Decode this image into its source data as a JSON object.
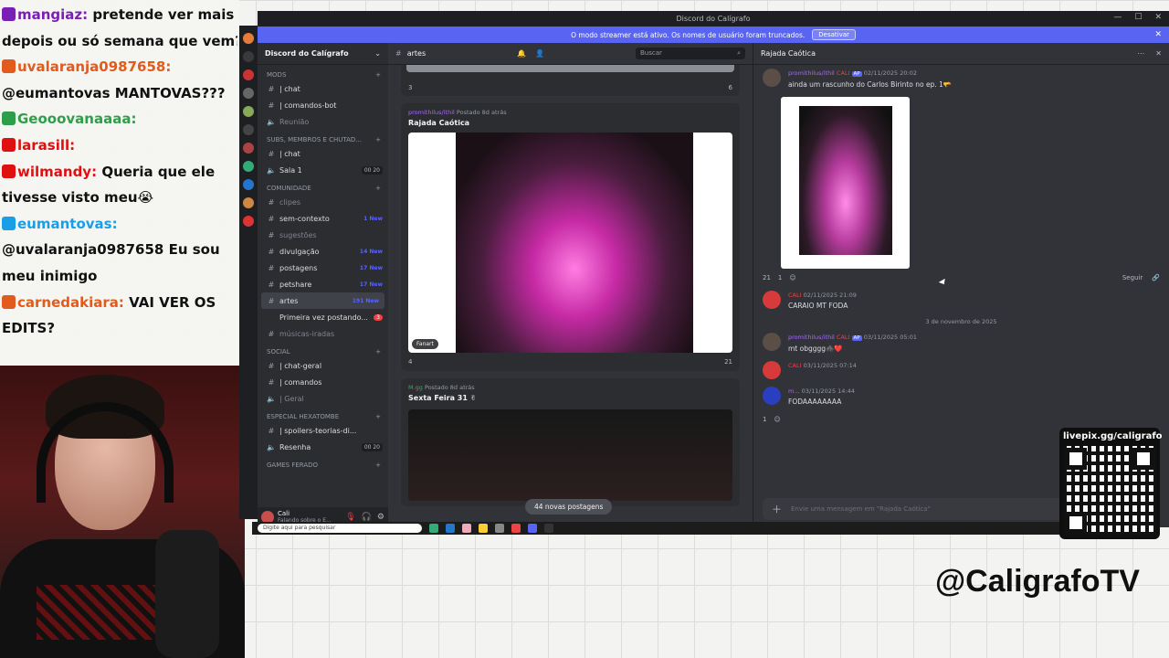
{
  "chat": {
    "lines": [
      {
        "user": "mangiaz:",
        "user_color": "#7a1fb3",
        "text": "pretende ver mais"
      },
      {
        "user": "",
        "text": "depois ou só semana que vem?"
      },
      {
        "user": "uvalaranja0987658:",
        "user_color": "#e25a1c",
        "text": ""
      },
      {
        "user": "",
        "text": "@eumantovas MANTOVAS???"
      },
      {
        "user": "Geooovanaaaa:",
        "user_color": "#2e9e4a",
        "text": ""
      },
      {
        "user": "larasill:",
        "user_color": "#e01010",
        "text": ""
      },
      {
        "user": "wilmandy:",
        "user_color": "#e01010",
        "text": "Queria que ele"
      },
      {
        "user": "",
        "text": "tivesse visto meu😭"
      },
      {
        "user": "eumantovas:",
        "user_color": "#1a9ee8",
        "text": ""
      },
      {
        "user": "",
        "text": "@uvalaranja0987658 Eu sou"
      },
      {
        "user": "",
        "text": "meu inimigo"
      },
      {
        "user": "carnedakiara:",
        "user_color": "#e25a1c",
        "text": "VAI VER OS"
      },
      {
        "user": "",
        "text": "EDITS?"
      }
    ]
  },
  "window": {
    "title": "Discord do Calígrafo",
    "controls": [
      "—",
      "☐",
      "✕"
    ]
  },
  "banner": {
    "text": "O modo streamer está ativo. Os nomes de usuário foram truncados.",
    "button": "Desativar",
    "close": "✕"
  },
  "server": {
    "name": "Discord do Calígrafo",
    "categories": [
      {
        "label": "MODS",
        "channels": [
          {
            "icon": "#",
            "name": "| chat"
          },
          {
            "icon": "#",
            "name": "| comandos-bot"
          },
          {
            "icon": "🔈",
            "name": "Reunião",
            "muted": true
          }
        ]
      },
      {
        "label": "SUBS, MEMBROS E CHUTAD...",
        "channels": [
          {
            "icon": "#",
            "name": "| chat"
          },
          {
            "icon": "🔈",
            "name": "Sala 1",
            "count": "00 20"
          }
        ]
      },
      {
        "label": "COMUNIDADE",
        "channels": [
          {
            "icon": "#",
            "name": "clipes",
            "muted": true
          },
          {
            "icon": "#",
            "name": "sem-contexto",
            "new": "1 New"
          },
          {
            "icon": "#",
            "name": "sugestões",
            "muted": true
          },
          {
            "icon": "#",
            "name": "divulgação",
            "new": "14 New"
          },
          {
            "icon": "#",
            "name": "postagens",
            "new": "17 New"
          },
          {
            "icon": "#",
            "name": "petshare",
            "new": "17 New"
          },
          {
            "icon": "#",
            "name": "artes",
            "new": "191 New",
            "active": true
          },
          {
            "icon": "",
            "name": "Primeira vez postando...",
            "badge": "3"
          },
          {
            "icon": "#",
            "name": "músicas-iradas",
            "muted": true
          }
        ]
      },
      {
        "label": "SOCIAL",
        "channels": [
          {
            "icon": "#",
            "name": "| chat-geral"
          },
          {
            "icon": "#",
            "name": "| comandos"
          },
          {
            "icon": "🔈",
            "name": "| Geral",
            "muted": true
          }
        ]
      },
      {
        "label": "ESPECIAL HEXATOMBE",
        "channels": [
          {
            "icon": "#",
            "name": "| spoilers-teorias-di..."
          },
          {
            "icon": "🔈",
            "name": "Resenha",
            "count": "00 20"
          }
        ]
      },
      {
        "label": "GAMES FERADO",
        "channels": []
      }
    ]
  },
  "user_panel": {
    "name": "Cali",
    "status": "Falando sobre o E..."
  },
  "forum": {
    "channel": "artes",
    "search_placeholder": "Buscar",
    "top_post": {
      "comments": "3",
      "reactions": "6"
    },
    "post1": {
      "author": "promithilus/ithil",
      "posted": "Postado 8d atrás",
      "title": "Rajada Caótica",
      "tag": "Fanart",
      "comments": "4",
      "reactions": "21"
    },
    "post2": {
      "author": "M.gg",
      "posted": "Postado 8d atrás",
      "title": "Sexta Feira 31 ✌"
    },
    "new_posts": "44 novas postagens"
  },
  "thread": {
    "title": "Rajada Caótica",
    "messages": [
      {
        "author": "promithilus/ithil",
        "tag": "CALI",
        "badge": "AP",
        "time": "02/11/2025 20:02",
        "text": "ainda um rascunho do Carlos Birinto no ep. 1🫳",
        "avatar_color": "#5a4e46"
      },
      {
        "author": "",
        "tag": "CALI",
        "time": "02/11/2025 21:09",
        "text": "CARAIO MT FODA",
        "avatar_color": "#d63a3a"
      },
      {
        "author": "promithilus/ithil",
        "tag": "CALI",
        "badge": "AP",
        "time": "03/11/2025 05:01",
        "text": "mt obgggg🕷️❤️",
        "avatar_color": "#5a4e46"
      },
      {
        "author": "",
        "tag": "CALI",
        "time": "03/11/2025 07:14",
        "text": "",
        "avatar_color": "#d63a3a"
      },
      {
        "author": "m...",
        "time": "03/11/2025 14:44",
        "text": "FODAAAAAAAA",
        "avatar_color": "#2a3fbf"
      }
    ],
    "reactions": {
      "first": "21",
      "second": "1",
      "last": "1"
    },
    "follow": "Seguir",
    "date_divider": "3 de novembro de 2025",
    "composer_placeholder": "Envie uma mensagem em \"Rajada Caótica\""
  },
  "taskbar": {
    "search": "Digite aqui para pesquisar"
  },
  "overlay": {
    "qr_label": "livepix.gg/caligrafo",
    "brand": "@CaligrafoTV"
  }
}
